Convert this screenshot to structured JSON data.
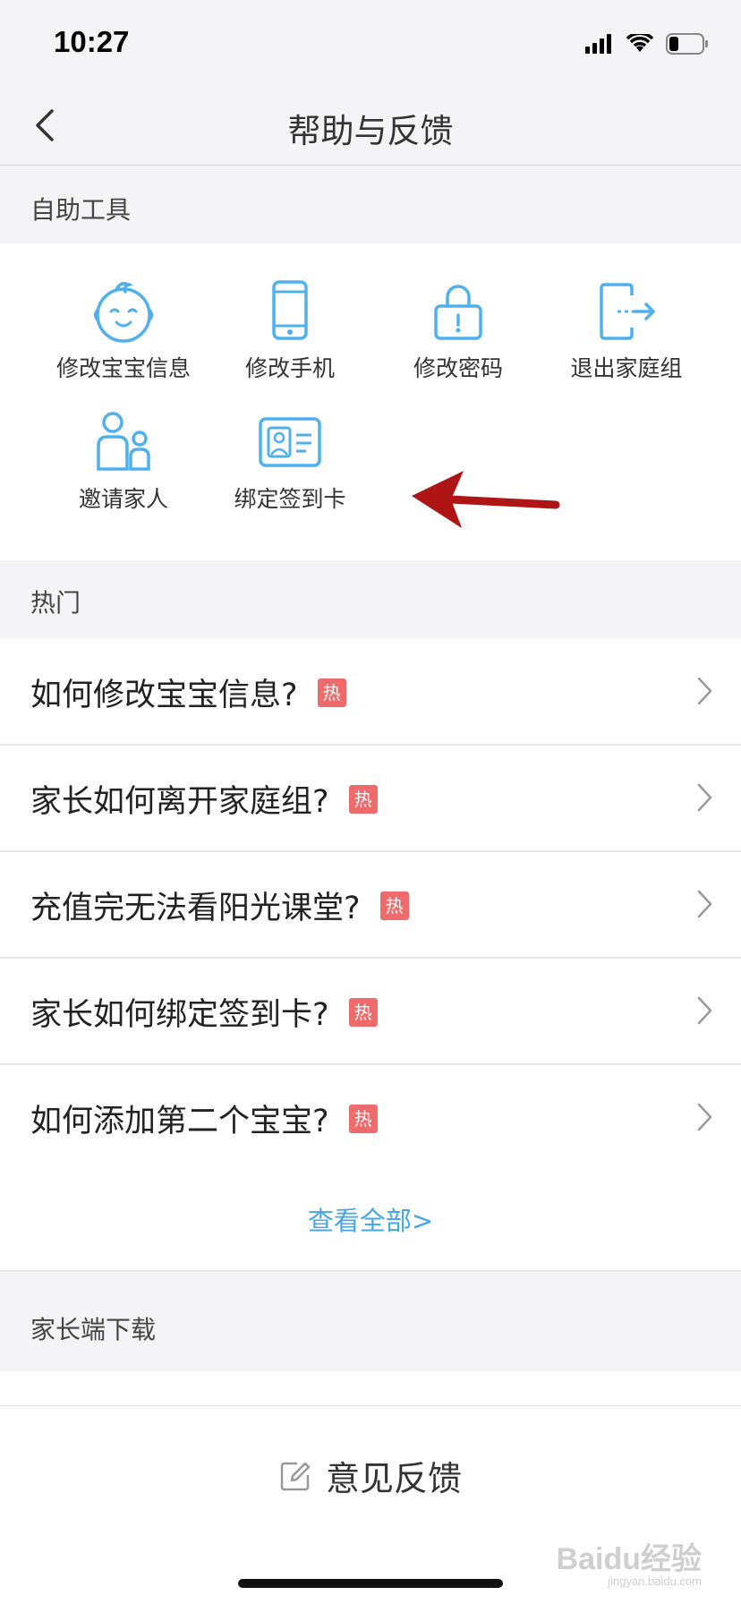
{
  "status_bar": {
    "time": "10:27",
    "icons": [
      "signal-icon",
      "wifi-icon",
      "battery-icon"
    ]
  },
  "nav": {
    "title": "帮助与反馈",
    "back_icon": "chevron-left-icon"
  },
  "sections": {
    "tools_header": "自助工具",
    "hot_header": "热门",
    "download_header": "家长端下载"
  },
  "tools": [
    {
      "label": "修改宝宝信息",
      "icon": "baby-face-icon"
    },
    {
      "label": "修改手机",
      "icon": "phone-icon"
    },
    {
      "label": "修改密码",
      "icon": "lock-icon"
    },
    {
      "label": "退出家庭组",
      "icon": "exit-icon"
    },
    {
      "label": "邀请家人",
      "icon": "family-icon"
    },
    {
      "label": "绑定签到卡",
      "icon": "id-card-icon"
    }
  ],
  "hot_questions": [
    {
      "text": "如何修改宝宝信息?",
      "badge": "热"
    },
    {
      "text": "家长如何离开家庭组?",
      "badge": "热"
    },
    {
      "text": "充值完无法看阳光课堂?",
      "badge": "热"
    },
    {
      "text": "家长如何绑定签到卡?",
      "badge": "热"
    },
    {
      "text": "如何添加第二个宝宝?",
      "badge": "热"
    }
  ],
  "view_all": "查看全部>",
  "feedback": {
    "label": "意见反馈",
    "icon": "edit-icon"
  },
  "watermark": {
    "main": "Baidu经验",
    "sub": "jingyan.baidu.com"
  },
  "colors": {
    "accent": "#45a7e6",
    "icon": "#4fb0ee",
    "badge": "#ef6b6b",
    "arrow": "#b01515"
  }
}
